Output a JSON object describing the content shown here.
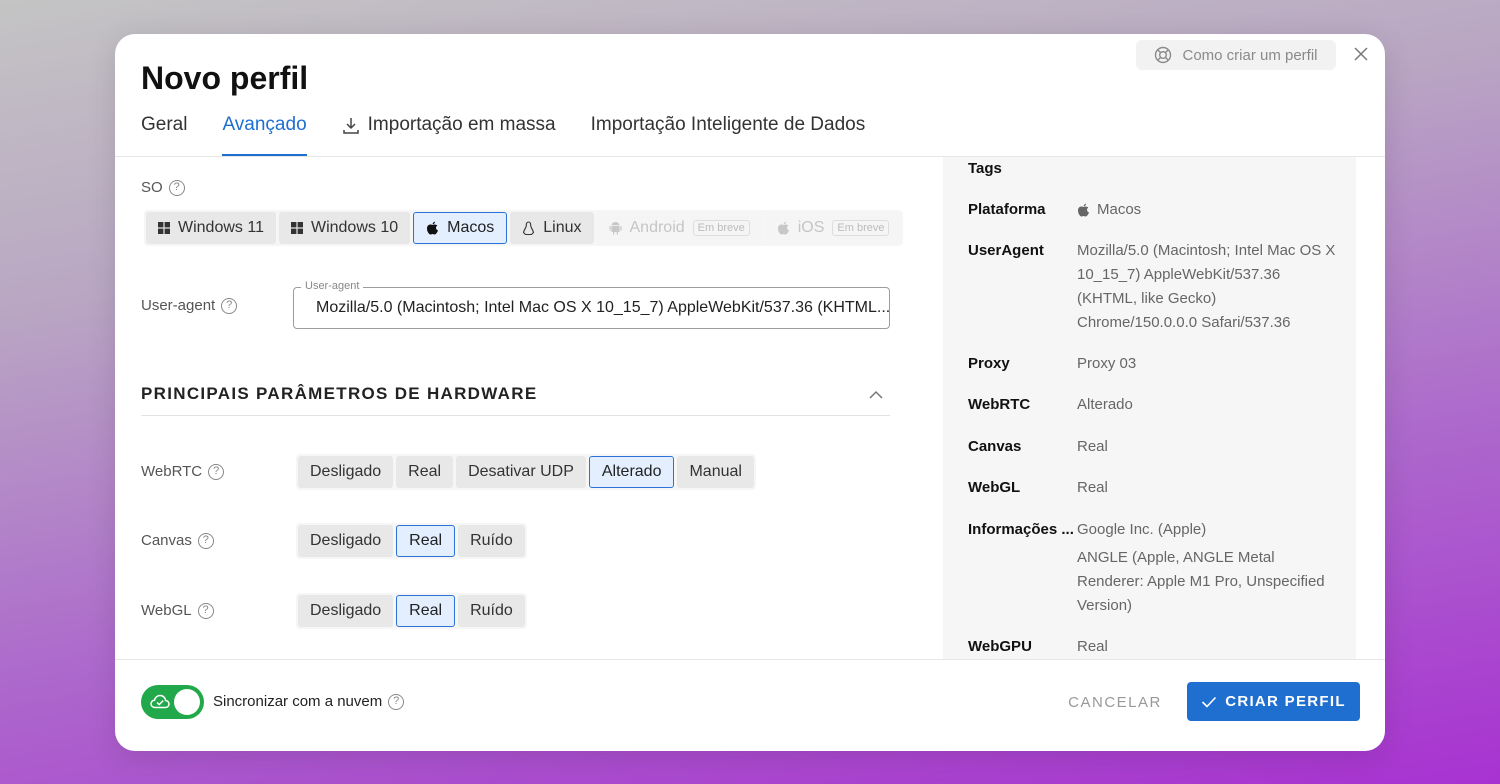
{
  "modal": {
    "title": "Novo perfil",
    "help_label": "Como criar um perfil"
  },
  "tabs": [
    {
      "label": "Geral",
      "active": false
    },
    {
      "label": "Avançado",
      "active": true
    },
    {
      "label": "Importação em massa",
      "icon": "download-icon",
      "active": false
    },
    {
      "label": "Importação Inteligente de Dados",
      "active": false
    }
  ],
  "os": {
    "label": "SO",
    "options": [
      {
        "label": "Windows 11",
        "icon": "windows-icon"
      },
      {
        "label": "Windows 10",
        "icon": "windows-icon"
      },
      {
        "label": "Macos",
        "icon": "apple-icon",
        "selected": true
      },
      {
        "label": "Linux",
        "icon": "linux-icon"
      },
      {
        "label": "Android",
        "icon": "android-icon",
        "badge": "Em breve",
        "disabled": true
      },
      {
        "label": "iOS",
        "icon": "apple-icon",
        "badge": "Em breve",
        "disabled": true
      }
    ]
  },
  "user_agent": {
    "label": "User-agent",
    "legend": "User-agent",
    "value": "Mozilla/5.0 (Macintosh; Intel Mac OS X 10_15_7) AppleWebKit/537.36 (KHTML..."
  },
  "hardware": {
    "title": "PRINCIPAIS PARÂMETROS DE HARDWARE",
    "webrtc": {
      "label": "WebRTC",
      "options": [
        "Desligado",
        "Real",
        "Desativar UDP",
        "Alterado",
        "Manual"
      ],
      "selected": "Alterado"
    },
    "canvas": {
      "label": "Canvas",
      "options": [
        "Desligado",
        "Real",
        "Ruído"
      ],
      "selected": "Real"
    },
    "webgl": {
      "label": "WebGL",
      "options": [
        "Desligado",
        "Real",
        "Ruído"
      ],
      "selected": "Real"
    }
  },
  "summary": [
    {
      "key": "Tags",
      "value": ""
    },
    {
      "key": "Plataforma",
      "value": "Macos",
      "icon": "apple-icon"
    },
    {
      "key": "UserAgent",
      "value": "Mozilla/5.0 (Macintosh; Intel Mac OS X 10_15_7) AppleWebKit/537.36 (KHTML, like Gecko) Chrome/150.0.0.0 Safari/537.36"
    },
    {
      "key": "Proxy",
      "value": "Proxy 03"
    },
    {
      "key": "WebRTC",
      "value": "Alterado"
    },
    {
      "key": "Canvas",
      "value": "Real"
    },
    {
      "key": "WebGL",
      "value": "Real"
    },
    {
      "key": "Informações ...",
      "value": "Google Inc. (Apple)",
      "value2": "ANGLE (Apple, ANGLE Metal Renderer: Apple M1 Pro, Unspecified Version)"
    },
    {
      "key": "WebGPU",
      "value": "Real"
    }
  ],
  "footer": {
    "sync_label": "Sincronizar com a nuvem",
    "sync_on": true,
    "cancel_label": "CANCELAR",
    "create_label": "CRIAR PERFIL"
  },
  "colors": {
    "accent": "#1f6fd1",
    "toggle": "#21a84a"
  }
}
